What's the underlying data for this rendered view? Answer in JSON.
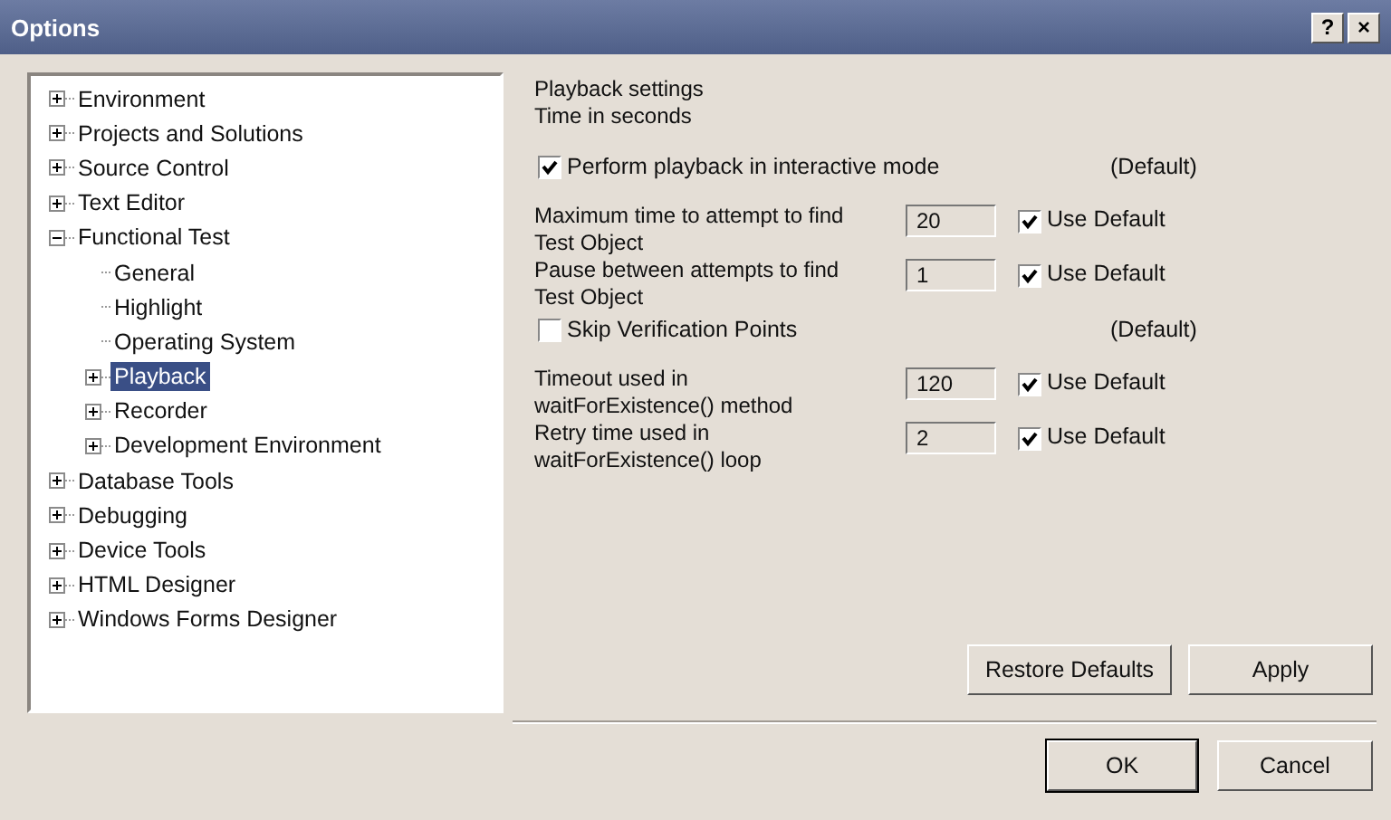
{
  "window": {
    "title": "Options",
    "buttons": [
      "?",
      "×"
    ]
  },
  "tree": [
    {
      "label": "Environment",
      "expanded": false,
      "selected": false
    },
    {
      "label": "Projects and Solutions",
      "expanded": false,
      "selected": false
    },
    {
      "label": "Source Control",
      "expanded": false,
      "selected": false
    },
    {
      "label": "Text Editor",
      "expanded": false,
      "selected": false
    },
    {
      "label": "Functional Test",
      "expanded": true,
      "selected": false,
      "children": [
        {
          "label": "General",
          "selected": false
        },
        {
          "label": "Highlight",
          "selected": false
        },
        {
          "label": "Operating System",
          "selected": false
        },
        {
          "label": "Playback",
          "expanded": false,
          "selected": true
        },
        {
          "label": "Recorder",
          "expanded": false,
          "selected": false
        },
        {
          "label": "Development Environment",
          "expanded": false,
          "selected": false
        }
      ]
    },
    {
      "label": "Database Tools",
      "expanded": false,
      "selected": false
    },
    {
      "label": "Debugging",
      "expanded": false,
      "selected": false
    },
    {
      "label": "Device Tools",
      "expanded": false,
      "selected": false
    },
    {
      "label": "HTML Designer",
      "expanded": false,
      "selected": false
    },
    {
      "label": "Windows Forms Designer",
      "expanded": false,
      "selected": false
    }
  ],
  "settings": {
    "heading": "Playback settings",
    "subheading": "Time in seconds",
    "rows": [
      {
        "kind": "checkbox",
        "label": "Perform playback in interactive mode",
        "checked": true,
        "note": "(Default)"
      },
      {
        "kind": "field",
        "label": [
          "Maximum time to attempt to find",
          "Test Object"
        ],
        "value": "20",
        "use_default_label": "Use Default",
        "use_default": true
      },
      {
        "kind": "field",
        "label": [
          "Pause between attempts to find",
          "Test Object"
        ],
        "value": "1",
        "use_default_label": "Use Default",
        "use_default": true
      },
      {
        "kind": "checkbox",
        "label": "Skip Verification Points",
        "checked": false,
        "note": "(Default)"
      },
      {
        "kind": "field",
        "label": [
          "Timeout used in",
          "waitForExistence() method"
        ],
        "value": "120",
        "use_default_label": "Use Default",
        "use_default": true
      },
      {
        "kind": "field",
        "label": [
          "Retry time used in",
          "waitForExistence() loop"
        ],
        "value": "2",
        "use_default_label": "Use Default",
        "use_default": true
      }
    ]
  },
  "page_buttons": [
    "Restore Defaults",
    "Apply"
  ],
  "dialog_buttons": [
    "OK",
    "Cancel"
  ]
}
